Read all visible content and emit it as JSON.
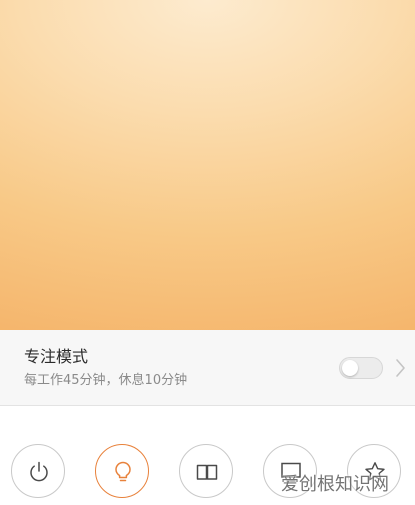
{
  "focus_mode": {
    "title": "专注模式",
    "description": "每工作45分钟，休息10分钟",
    "enabled": false
  },
  "mode_buttons": [
    {
      "name": "power",
      "icon": "power-icon",
      "active": false
    },
    {
      "name": "light",
      "icon": "bulb-icon",
      "active": true
    },
    {
      "name": "reading",
      "icon": "book-icon",
      "active": false
    },
    {
      "name": "screen",
      "icon": "monitor-icon",
      "active": false
    },
    {
      "name": "favorite",
      "icon": "star-icon",
      "active": false
    }
  ],
  "colors": {
    "accent": "#e8823c",
    "light_preview": "#f8c987"
  },
  "watermark": "爱创根知识网"
}
